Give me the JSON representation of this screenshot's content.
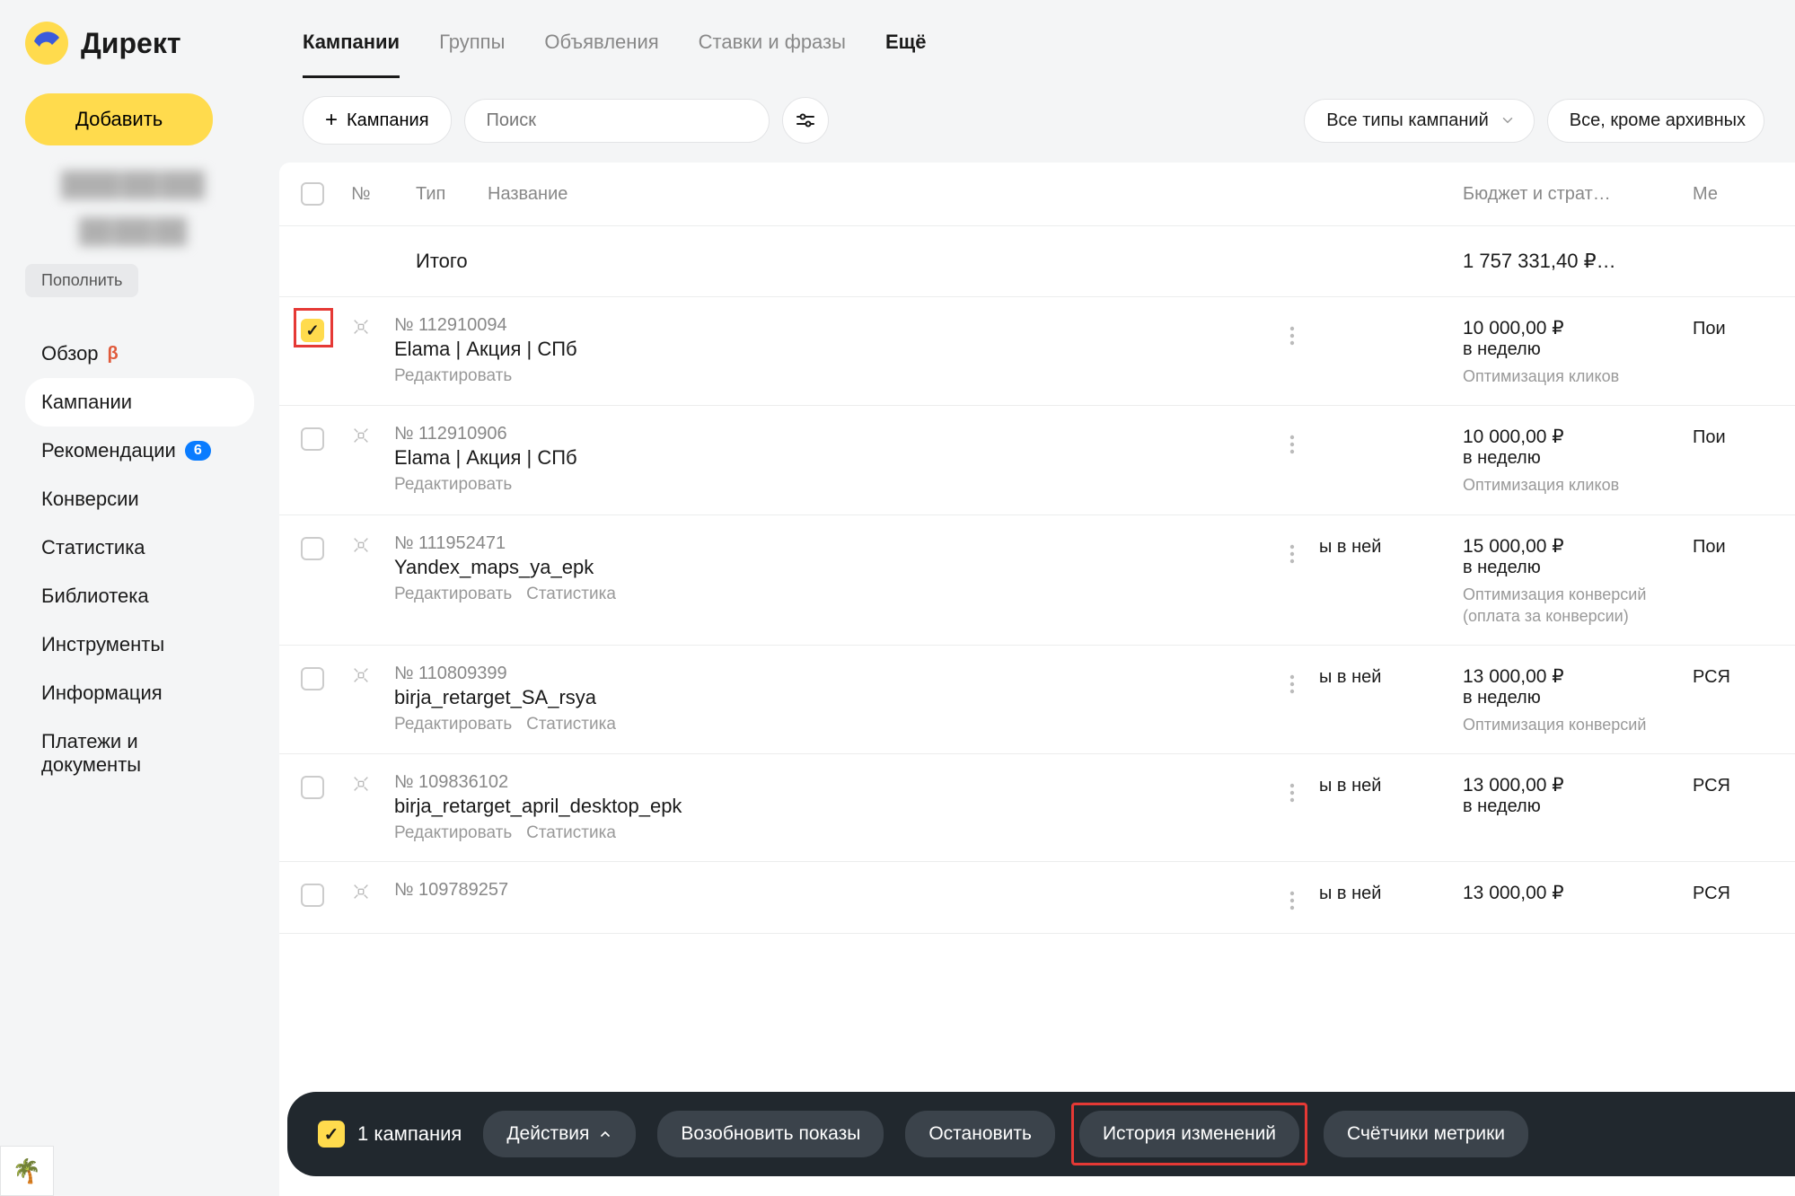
{
  "app_name": "Директ",
  "sidebar": {
    "add_label": "Добавить",
    "topup_label": "Пополнить",
    "nav": [
      {
        "label": "Обзор",
        "beta": "β"
      },
      {
        "label": "Кампании",
        "active": true
      },
      {
        "label": "Рекомендации",
        "badge": "6"
      },
      {
        "label": "Конверсии"
      },
      {
        "label": "Статистика"
      },
      {
        "label": "Библиотека"
      },
      {
        "label": "Инструменты"
      },
      {
        "label": "Информация"
      },
      {
        "label": "Платежи и документы"
      }
    ]
  },
  "tabs": [
    {
      "label": "Кампании",
      "active": true
    },
    {
      "label": "Группы"
    },
    {
      "label": "Объявления"
    },
    {
      "label": "Ставки и фразы"
    },
    {
      "label": "Ещё",
      "more": true
    }
  ],
  "toolbar": {
    "add_campaign": "Кампания",
    "search_placeholder": "Поиск",
    "filter1": "Все типы кампаний",
    "filter2": "Все, кроме архивных"
  },
  "columns": {
    "num": "№",
    "type": "Тип",
    "name": "Название",
    "budget": "Бюджет и страт…",
    "place": "Ме"
  },
  "total": {
    "label": "Итого",
    "value": "1 757 331,40 ₽…"
  },
  "rows": [
    {
      "id": "№ 112910094",
      "name": "Elama | Акция | СПб",
      "links": [
        "Редактировать"
      ],
      "checked": true,
      "budget": "10 000,00 ₽",
      "period": "в неделю",
      "strategy": "Оптимизация кликов",
      "place": "Пои",
      "extra": "",
      "highlight": true
    },
    {
      "id": "№ 112910906",
      "name": "Elama | Акция | СПб",
      "links": [
        "Редактировать"
      ],
      "budget": "10 000,00 ₽",
      "period": "в неделю",
      "strategy": "Оптимизация кликов",
      "place": "Пои",
      "extra": ""
    },
    {
      "id": "№ 111952471",
      "name": "Yandex_maps_ya_epk",
      "links": [
        "Редактировать",
        "Статистика"
      ],
      "budget": "15 000,00 ₽",
      "period": "в неделю",
      "strategy": "Оптимизация конверсий (оплата за конверсии)",
      "place": "Пои",
      "extra": "ы в ней"
    },
    {
      "id": "№ 110809399",
      "name": "birja_retarget_SA_rsya",
      "links": [
        "Редактировать",
        "Статистика"
      ],
      "budget": "13 000,00 ₽",
      "period": "в неделю",
      "strategy": "Оптимизация конверсий",
      "place": "РСЯ",
      "extra": "ы в ней"
    },
    {
      "id": "№ 109836102",
      "name": "birja_retarget_april_desktop_epk",
      "links": [
        "Редактировать",
        "Статистика"
      ],
      "budget": "13 000,00 ₽",
      "period": "в неделю",
      "strategy": "",
      "place": "РСЯ",
      "extra": "ы в ней"
    },
    {
      "id": "№ 109789257",
      "name": "",
      "links": [],
      "budget": "13 000,00 ₽",
      "period": "",
      "strategy": "",
      "place": "РСЯ",
      "extra": "ы в ней"
    }
  ],
  "bottom_bar": {
    "selected": "1 кампания",
    "actions": "Действия",
    "resume": "Возобновить показы",
    "stop": "Остановить",
    "history": "История изменений",
    "metrics": "Счётчики метрики"
  },
  "icons": {
    "palm": "🌴"
  },
  "colors": {
    "accent": "#ffdb4d",
    "highlight": "#e53935",
    "link_badge": "#0a7cff"
  }
}
